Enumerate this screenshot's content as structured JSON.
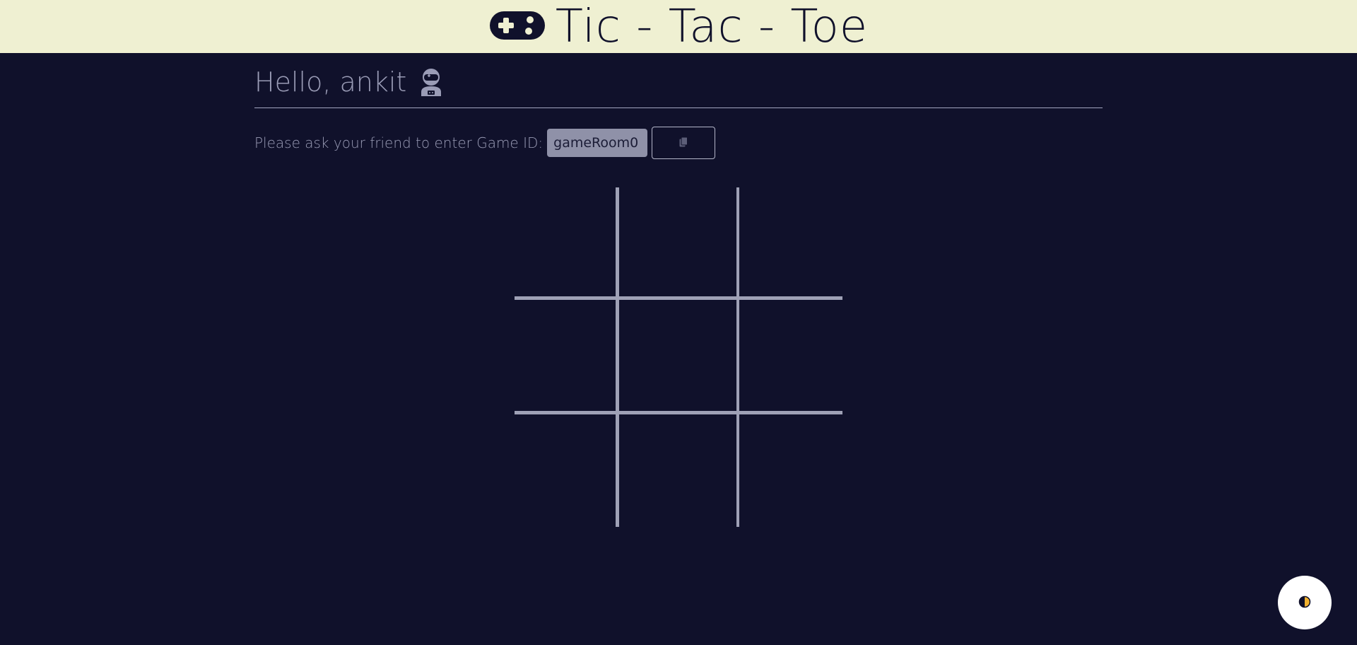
{
  "header": {
    "title": "Tic - Tac - Toe",
    "logo_icon": "gamepad-icon"
  },
  "greeting": {
    "text": "Hello, ankit",
    "avatar_icon": "astronaut-icon"
  },
  "game_id": {
    "label": "Please ask your friend to enter Game ID:",
    "value": "gameRoom0",
    "copy_icon": "copy-icon"
  },
  "board": {
    "cells": [
      "",
      "",
      "",
      "",
      "",
      "",
      "",
      "",
      ""
    ]
  },
  "theme_toggle": {
    "icon": "half-moon-icon"
  },
  "colors": {
    "background": "#10112b",
    "header_background": "#eff0d2",
    "text": "#9a9cb6",
    "grid_lines": "#9fa1b6",
    "input_background": "#8f91a8",
    "toggle_accent": "#f2b230"
  }
}
